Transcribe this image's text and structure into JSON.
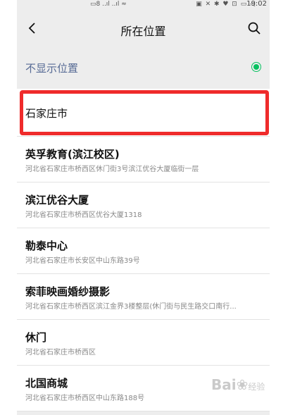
{
  "status_bar": {
    "left_icons": "▭8 ..ıl ..ıl ≈",
    "right_icons": "▣ ✕ ✱ ♥ ⊡ ▭ ◁",
    "time": "19:02"
  },
  "header": {
    "title": "所在位置",
    "back_icon": "chevron-left-icon",
    "search_icon": "search-icon"
  },
  "hide_location": {
    "label": "不显示位置",
    "selected": true,
    "accent_color": "#07c160"
  },
  "locations": [
    {
      "name": "石家庄市",
      "address": ""
    },
    {
      "name": "英孚教育(滨江校区)",
      "address": "河北省石家庄市桥西区休门街3号滨江优谷大厦临街一层"
    },
    {
      "name": "滨江优谷大厦",
      "address": "河北省石家庄市桥西区优谷大厦1318"
    },
    {
      "name": "勒泰中心",
      "address": "河北省石家庄市长安区中山东路39号"
    },
    {
      "name": "索菲映画婚纱摄影",
      "address": "河北省石家庄市桥西区滨江金界3楼整层(休门街与民生路交口南行..."
    },
    {
      "name": "休门",
      "address": "河北省石家庄市桥西区"
    },
    {
      "name": "北国商城",
      "address": "河北省石家庄市桥西区中山东路188号"
    }
  ],
  "highlight_color": "#ef2b2b",
  "watermark": {
    "brand": "Bai",
    "paw": "❀",
    "suffix": "经验"
  }
}
